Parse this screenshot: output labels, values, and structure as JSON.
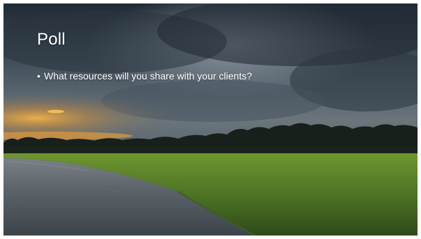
{
  "slide": {
    "title": "Poll",
    "bullets": [
      {
        "marker": "•",
        "text": "What resources will you share with your clients?"
      }
    ],
    "background_image": "stormy-marsh-landscape"
  },
  "colors": {
    "title_text": "#ffffff",
    "sky_dark": "#1f2a34",
    "sky_mid": "#53606c",
    "sunset": "#e8a33a",
    "treeline": "#17201a",
    "grass": "#5f8a2c",
    "water": "#5b646a"
  }
}
